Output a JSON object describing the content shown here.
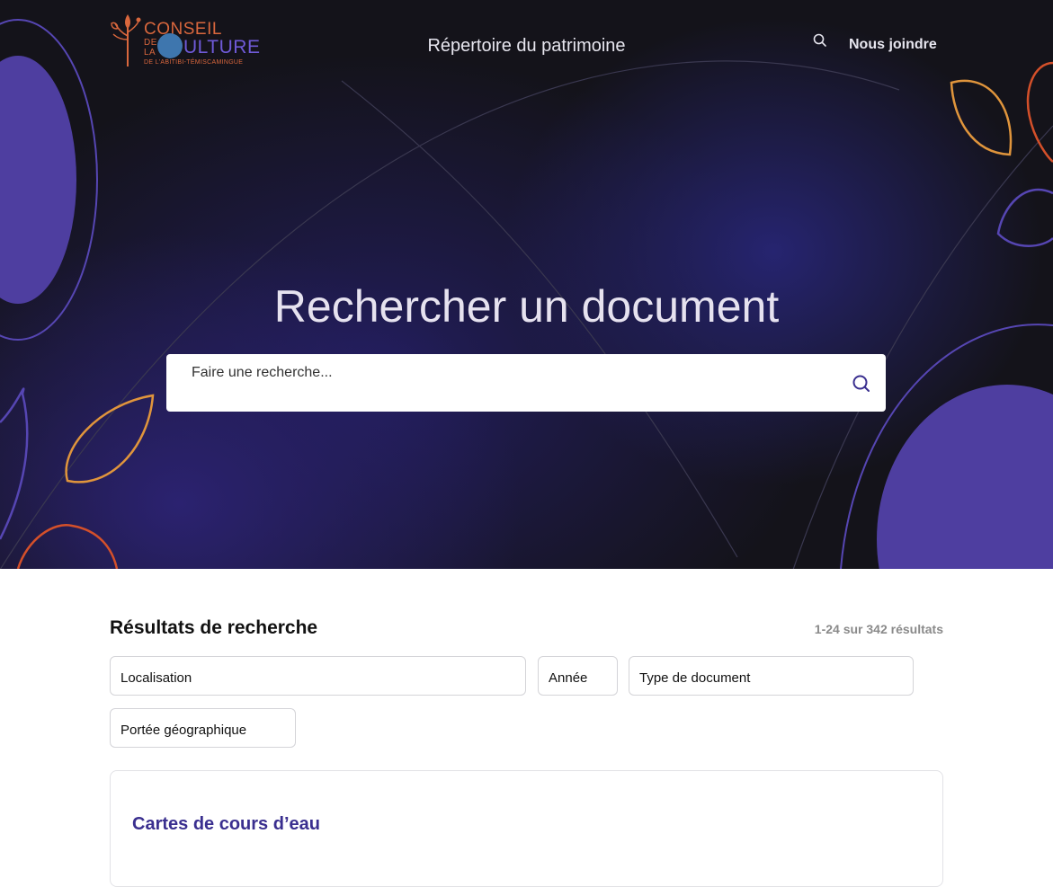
{
  "header": {
    "logo": {
      "line1": "CONSEIL",
      "de": "DE",
      "la": "LA",
      "line2": "ULTURE",
      "sub": "DE L'ABITIBI-TÉMISCAMINGUE"
    },
    "nav_title": "Répertoire du patrimoine",
    "search_icon": "search-icon",
    "join_label": "Nous joindre"
  },
  "hero": {
    "title": "Rechercher un document",
    "search_placeholder": "Faire une recherche...",
    "search_button_icon": "search-icon"
  },
  "results": {
    "title": "Résultats de recherche",
    "count": "1-24 sur 342 résultats",
    "filters": [
      "Localisation",
      "Année",
      "Type de document",
      "Portée géographique"
    ],
    "items": [
      {
        "title": "Cartes de cours d’eau"
      }
    ]
  },
  "colors": {
    "hero_bg": "#14131a",
    "accent_purple": "#4e3ea0",
    "accent_orange": "#e0953c",
    "accent_red": "#d4502a",
    "link": "#3a2f8f"
  }
}
